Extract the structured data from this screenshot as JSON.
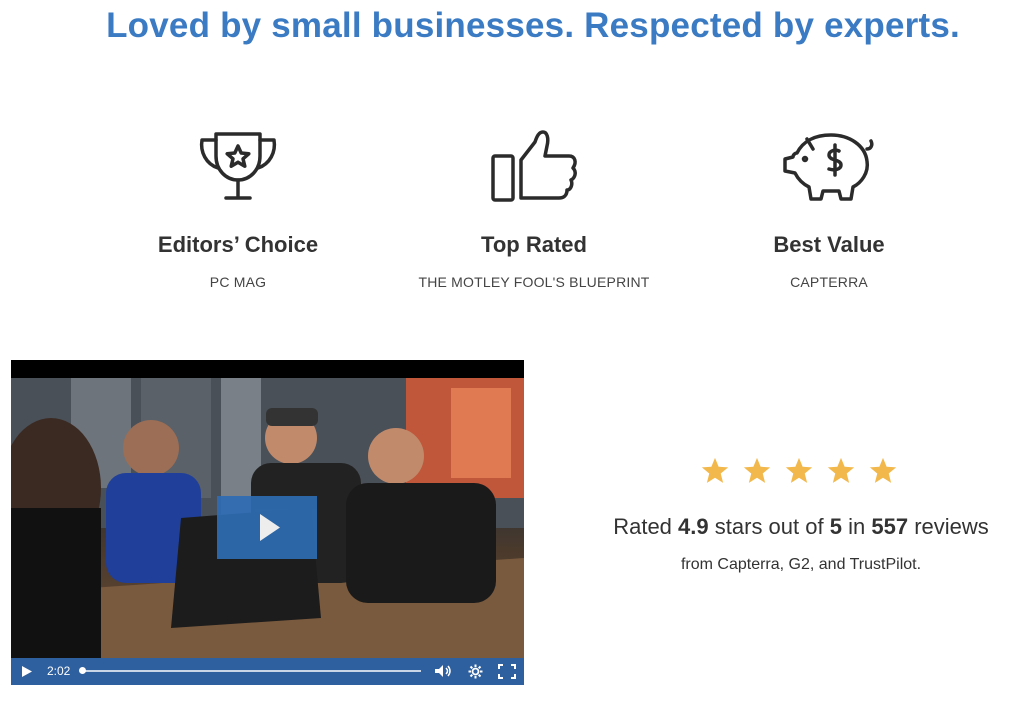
{
  "headline": "Loved by small businesses. Respected by experts.",
  "awards": [
    {
      "icon": "trophy-icon",
      "title": "Editors’ Choice",
      "source": "PC MAG"
    },
    {
      "icon": "thumbs-up-icon",
      "title": "Top Rated",
      "source": "THE MOTLEY FOOL'S BLUEPRINT"
    },
    {
      "icon": "piggy-bank-icon",
      "title": "Best Value",
      "source": "CAPTERRA"
    }
  ],
  "video": {
    "time": "2:02",
    "progress": 0.0
  },
  "rating": {
    "prefix": "Rated",
    "score": "4.9",
    "mid": "stars out of",
    "max": "5",
    "in": "in",
    "count": "557",
    "suffix": "reviews",
    "stars": 5,
    "from": "from Capterra, G2, and TrustPilot."
  },
  "colors": {
    "accent": "#3a7bc4",
    "star": "#f2b84b",
    "video_controls": "#2e5f9e"
  }
}
